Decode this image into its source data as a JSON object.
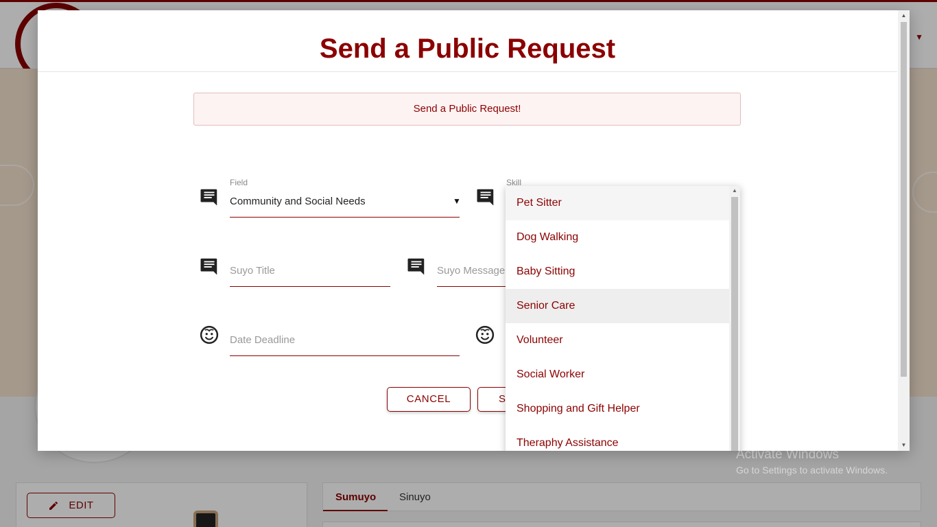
{
  "background": {
    "edit_label": "EDIT",
    "tabs": [
      "Sumuyo",
      "Sinuyo"
    ]
  },
  "watermark": {
    "line1": "Activate Windows",
    "line2": "Go to Settings to activate Windows."
  },
  "modal": {
    "title": "Send a Public Request",
    "alert": "Send a Public Request!",
    "field": {
      "label": "Field",
      "value": "Community and Social Needs"
    },
    "skill": {
      "label": "Skill"
    },
    "title_input": {
      "placeholder": "Suyo Title"
    },
    "message_input": {
      "placeholder": "Suyo Message"
    },
    "deadline_input": {
      "placeholder": "Date Deadline"
    },
    "cancel_label": "CANCEL",
    "submit_label": "S",
    "icons": {
      "chat": "chat-bubble-icon",
      "face": "face-icon"
    }
  },
  "skill_options": [
    "Pet Sitter",
    "Dog Walking",
    "Baby Sitting",
    "Senior Care",
    "Volunteer",
    "Social Worker",
    "Shopping and Gift Helper",
    "Theraphy Assistance"
  ],
  "colors": {
    "accent": "#8b0000",
    "alert_bg": "#fdf3f3"
  }
}
